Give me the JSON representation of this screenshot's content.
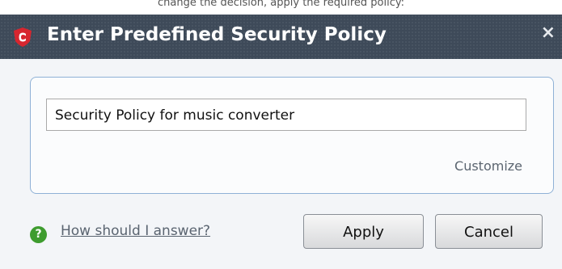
{
  "top_caption": "change the decision, apply the required policy:",
  "dialog": {
    "title": "Enter Predefined Security Policy",
    "close_label": "×",
    "policy_value": "Security Policy for music converter",
    "customize_label": "Customize",
    "help_label": "How should I answer?",
    "apply_label": "Apply",
    "cancel_label": "Cancel"
  },
  "icons": {
    "app": "comodo-shield-icon",
    "help": "question-mark-icon"
  },
  "colors": {
    "titlebar": "#3e4a59",
    "app_icon": "#d7262f",
    "help_icon": "#3e9c2f",
    "box_border": "#8fb1d6"
  }
}
